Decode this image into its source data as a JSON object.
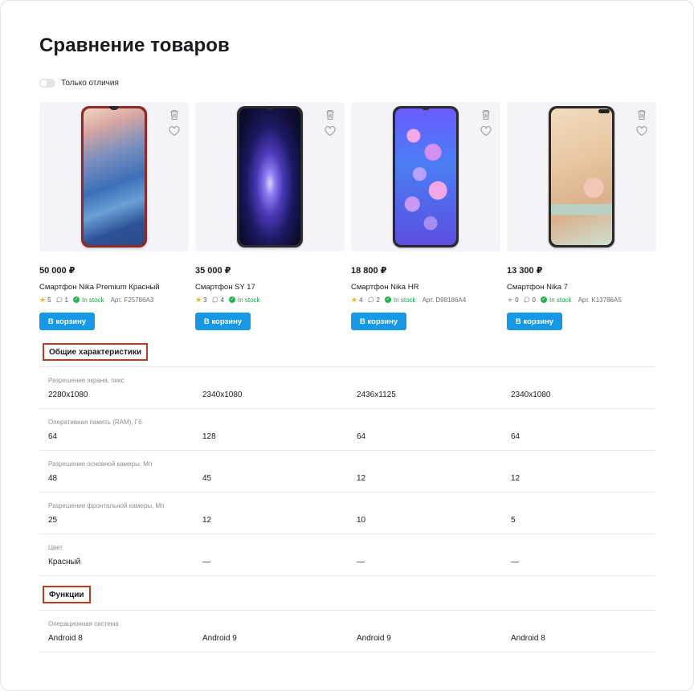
{
  "page": {
    "title": "Сравнение товаров"
  },
  "toggle": {
    "label": "Только отличия",
    "on": false
  },
  "colors": {
    "accent": "#1798e6",
    "stock": "#23b24c",
    "star": "#f2b21c",
    "section_outline": "#c1391f"
  },
  "buy_label": "В корзину",
  "stock_label": "In stock",
  "products": [
    {
      "price": "50 000 ₽",
      "name": "Смартфон Nika Premium Красный",
      "rating": "5",
      "comments": "1",
      "article": "Арт. F25786A3",
      "rated": true
    },
    {
      "price": "35 000 ₽",
      "name": "Смартфон SY 17",
      "rating": "3",
      "comments": "4",
      "article": "",
      "rated": true
    },
    {
      "price": "18 800 ₽",
      "name": "Смартфон Nika HR",
      "rating": "4",
      "comments": "2",
      "article": "Арт. D98186A4",
      "rated": true
    },
    {
      "price": "13 300 ₽",
      "name": "Смартфон Nika 7",
      "rating": "0",
      "comments": "0",
      "article": "Арт. K13786A5",
      "rated": false
    }
  ],
  "sections": {
    "general": {
      "title": "Общие характеристики",
      "rows": [
        {
          "label": "Разрешение экрана, пикс",
          "values": [
            "2280x1080",
            "2340x1080",
            "2436x1125",
            "2340x1080"
          ]
        },
        {
          "label": "Оперативная память (RAM), Гб",
          "values": [
            "64",
            "128",
            "64",
            "64"
          ]
        },
        {
          "label": "Разрешение основной камеры, Мп",
          "values": [
            "48",
            "45",
            "12",
            "12"
          ]
        },
        {
          "label": "Разрешение фронтальной камеры, Мп",
          "values": [
            "25",
            "12",
            "10",
            "5"
          ]
        },
        {
          "label": "Цвет",
          "values": [
            "Красный",
            "—",
            "—",
            "—"
          ]
        }
      ]
    },
    "functions": {
      "title": "Функции",
      "rows": [
        {
          "label": "Операционная система",
          "values": [
            "Android 8",
            "Android 9",
            "Android 9",
            "Android 8"
          ]
        }
      ]
    }
  }
}
